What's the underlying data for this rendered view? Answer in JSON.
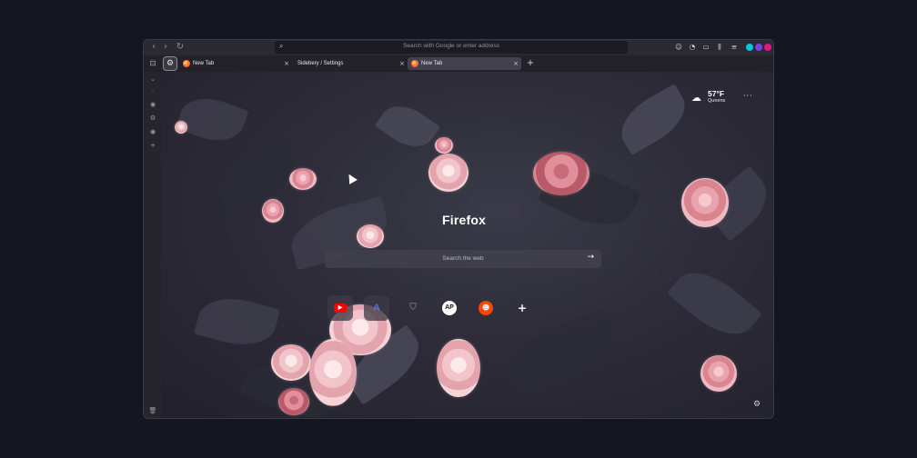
{
  "toolbar": {
    "back_icon": "chevron-left-icon",
    "forward_icon": "chevron-right-icon",
    "reload_icon": "reload-icon",
    "url_placeholder": "Search with Google or enter address",
    "extension_colors": [
      "#00c8d7",
      "#7542e5",
      "#e31587"
    ]
  },
  "tabs": [
    {
      "label": "New Tab",
      "active": false
    },
    {
      "label": "Sidebery / Settings",
      "active": false
    },
    {
      "label": "New Tab",
      "active": true
    }
  ],
  "newtab": {
    "brand": "Firefox",
    "search_placeholder": "Search the web",
    "weather": {
      "temp": "57°F",
      "location": "Queens"
    },
    "shortcuts": [
      {
        "name": "youtube",
        "glyph": "▶",
        "color": "#ff0000"
      },
      {
        "name": "amazon-a",
        "glyph": "A",
        "color": "#4a7bd6"
      },
      {
        "name": "shield",
        "glyph": "",
        "color": "#6d6c78"
      },
      {
        "name": "ap",
        "glyph": "AP",
        "color": "#ffffff"
      },
      {
        "name": "reddit",
        "glyph": "●",
        "color": "#ff4500"
      },
      {
        "name": "add",
        "glyph": "+",
        "color": "#ffffff"
      }
    ]
  }
}
